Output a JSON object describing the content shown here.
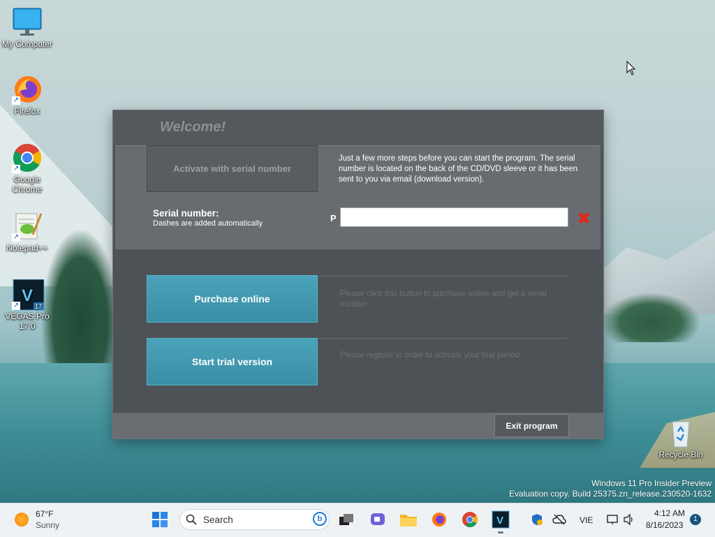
{
  "desktop": {
    "icons": [
      {
        "label": "My Computer"
      },
      {
        "label": "Firefox"
      },
      {
        "label": "Google Chrome"
      },
      {
        "label": "Notepad++"
      },
      {
        "label": "VEGAS Pro 17.0"
      },
      {
        "label": "Recycle Bin"
      }
    ]
  },
  "dialog": {
    "title": "Welcome!",
    "activate_label": "Activate with serial number",
    "info_text": "Just a few more steps before you can start the program. The serial number is located on the back of the CD/DVD sleeve or it has been sent to you via email (download version).",
    "serial_label": "Serial number:",
    "serial_sub": "Dashes are added automatically",
    "serial_prefix": "P",
    "serial_value": "",
    "purchase_label": "Purchase online",
    "purchase_desc": "Please click this button to purchase online and get a serial number.",
    "trial_label": "Start trial version",
    "trial_desc": "Please register in order to activate your trial period.",
    "exit_label": "Exit program"
  },
  "watermark": {
    "line1": "Windows 11 Pro Insider Preview",
    "line2": "Evaluation copy. Build 25375.zn_release.230520-1632"
  },
  "taskbar": {
    "weather_temp": "67°F",
    "weather_cond": "Sunny",
    "search_placeholder": "Search",
    "language": "VIE",
    "time": "4:12 AM",
    "date": "8/16/2023",
    "notification_count": "1"
  },
  "colors": {
    "accent_teal": "#3d93ab",
    "dialog_bg": "#4d5257",
    "panel_bg": "#686c71",
    "clear_red": "#e02a1a"
  }
}
